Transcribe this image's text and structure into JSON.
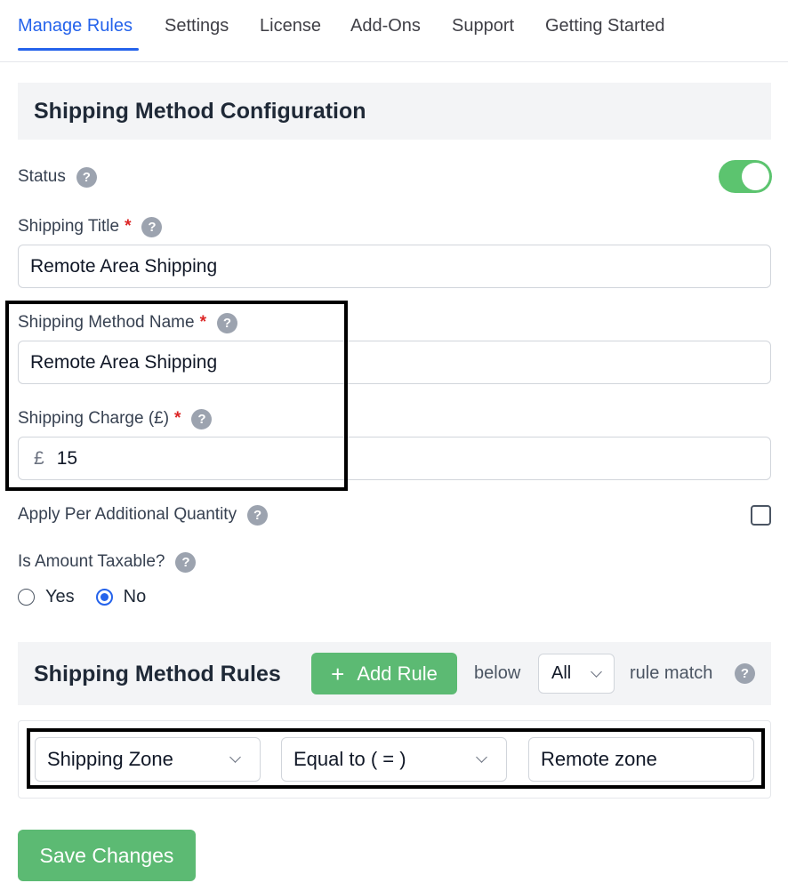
{
  "nav": {
    "tabs": [
      {
        "label": "Manage Rules",
        "active": true
      },
      {
        "label": "Settings"
      },
      {
        "label": "License"
      },
      {
        "label": "Add-Ons"
      },
      {
        "label": "Support"
      },
      {
        "label": "Getting Started"
      }
    ]
  },
  "config": {
    "title": "Shipping Method Configuration",
    "status_label": "Status",
    "status_on": true,
    "shipping_title_label": "Shipping Title",
    "shipping_title_value": "Remote Area Shipping",
    "method_name_label": "Shipping Method Name",
    "method_name_value": "Remote Area Shipping",
    "charge_label": "Shipping Charge (£)",
    "currency_symbol": "£",
    "charge_value": "15",
    "per_qty_label": "Apply Per Additional Quantity",
    "per_qty_checked": false,
    "taxable_label": "Is Amount Taxable?",
    "taxable_options": [
      "Yes",
      "No"
    ],
    "taxable_selected": "No",
    "required_mark": "*",
    "help_glyph": "?"
  },
  "rules": {
    "title": "Shipping Method Rules",
    "add_rule_label": "Add Rule",
    "add_rule_icon": "+",
    "below_text": "below",
    "match_value": "All",
    "rule_match_text": "rule match",
    "row": {
      "field": "Shipping Zone",
      "operator": "Equal to ( = )",
      "value": "Remote zone"
    }
  },
  "save_label": "Save Changes",
  "colors": {
    "accent": "#2563eb",
    "green": "#5cba73",
    "toggle_green": "#5cc46f",
    "required": "#dc2626"
  }
}
